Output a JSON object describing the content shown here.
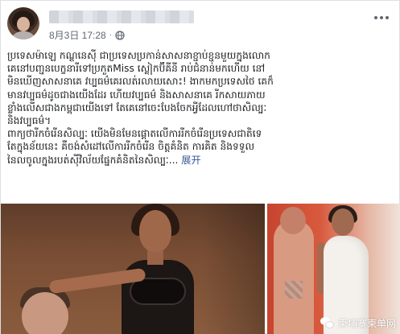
{
  "post": {
    "author_name": "",
    "timestamp": "8月3日 17:28",
    "separator": "·",
    "privacy_icon": "globe-icon",
    "more_icon": "more-options-icon"
  },
  "body": {
    "lines": [
      "ប្រទេសម៉ាឡេ កណ្តូនេស៊ី ជាប្រទេសប្រកាន់សាសនាខ្ជាប់ខ្ជួនមួយក្នុងលោក",
      "គេនៅបញ្ជូនបេក្ខនារីទៅប្រកួតMiss ស្លៀកប៊ីគីនី រាប់ជំនាន់មកហើយ នៅ",
      "មិនឃើញសាសនាគេ វប្បធម៌គេរលត់រលាយសោះ! ងាកមកប្រទេសថៃ គេក៏",
      "មានវប្បធម៌ដូចជាងយើងដែរ ហើយវប្បធម៌ និងសាសនាគេ រីកសាយភាយ",
      "ខ្លាំងលើសជាងកម្ពុជាយើងទៅ តែគេនៅចេះបែងចែកអ្វីដែលហៅថាសិល្បៈ",
      "និងវប្បធម៌។",
      "ពាក្យថារីកចំរើនសិល្បៈ យើងមិនមែនផ្តោតលើការរីកចំរើនប្រទេសជាតិទេ",
      "តែក្នុងន័យនេះ គឺចង់សំដៅលើការរីកចំរើន ចិត្តគំនិត ការគិត និងទទួល"
    ],
    "last_line": "នៃលចូលក្នុងរបត់ស៊ីវិល័យផ្នែកគំនិតនៃសិល្បៈ...",
    "see_more": "展开"
  },
  "watermark": {
    "icon": "wechat-icon",
    "text": "柬埔寨柬单网"
  },
  "colors": {
    "link": "#385898",
    "meta_text": "#616770",
    "border": "#dddfe2"
  }
}
